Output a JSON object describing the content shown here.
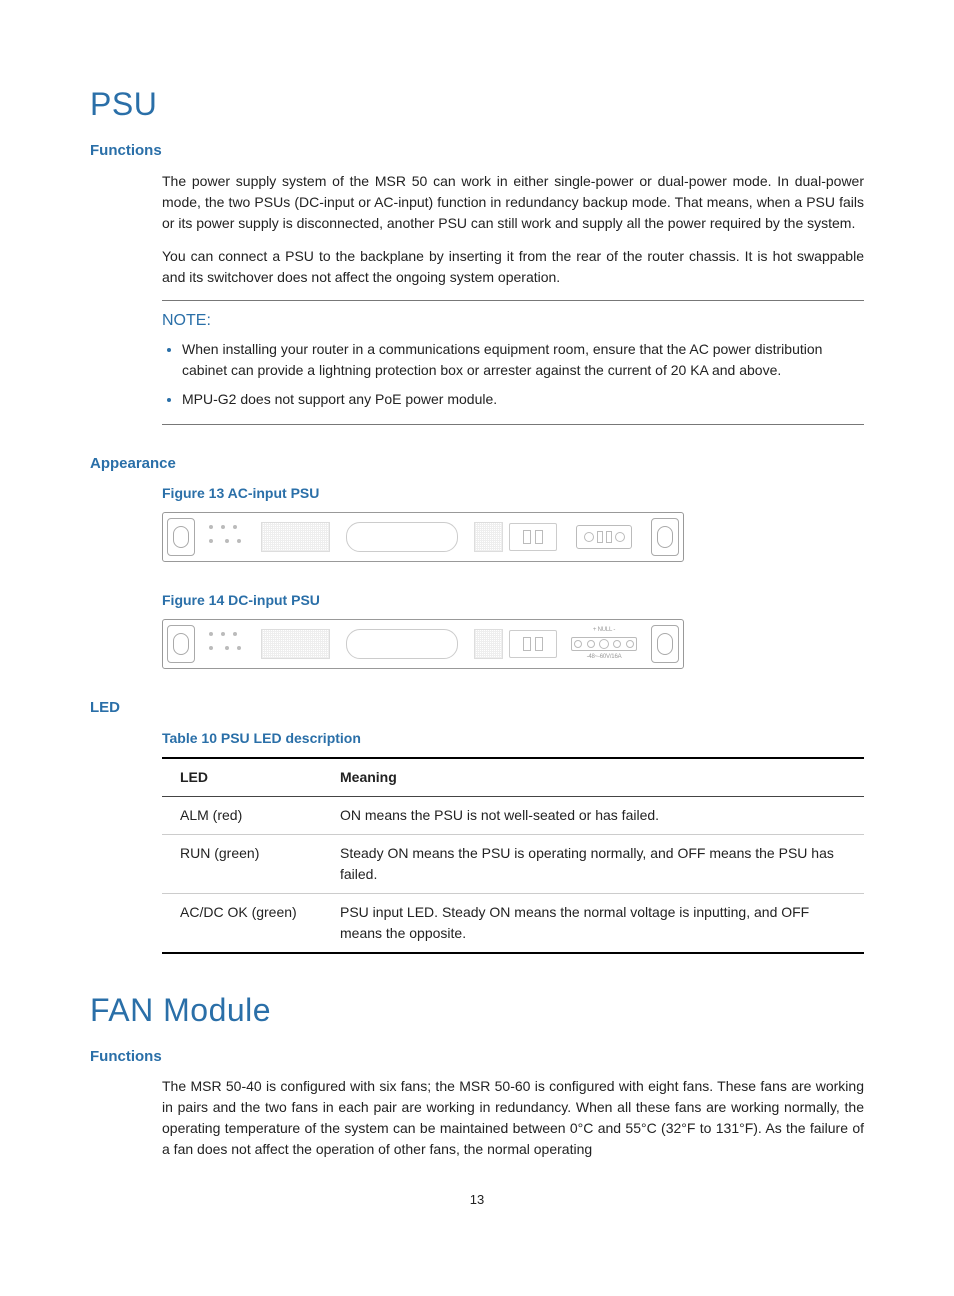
{
  "psu": {
    "title": "PSU",
    "functions": {
      "heading": "Functions",
      "p1": "The power supply system of the MSR 50 can work in either single-power or dual-power mode. In dual-power mode, the two PSUs (DC-input or AC-input) function in redundancy backup mode. That means, when a PSU fails or its power supply is disconnected, another PSU can still work and supply all the power required by the system.",
      "p2": "You can connect a PSU to the backplane by inserting it from the rear of the router chassis. It is hot swappable and its switchover does not affect the ongoing system operation."
    },
    "note": {
      "title": "NOTE:",
      "items": [
        "When installing your router in a communications equipment room, ensure that the AC power distribution cabinet can provide a lightning protection box or arrester against the current of 20 KA and above.",
        "MPU-G2 does not support any PoE power module."
      ]
    },
    "appearance": {
      "heading": "Appearance",
      "fig13": "Figure 13 AC-input PSU",
      "fig14": "Figure 14 DC-input PSU",
      "dc_labels": {
        "top": "+ NULL -",
        "bottom": "-48~-60V/16A"
      }
    },
    "led": {
      "heading": "LED",
      "table_caption": "Table 10 PSU LED description",
      "headers": {
        "c1": "LED",
        "c2": "Meaning"
      },
      "rows": [
        {
          "led": "ALM (red)",
          "meaning": "ON means the PSU is not well-seated or has failed."
        },
        {
          "led": "RUN (green)",
          "meaning": "Steady ON means the PSU is operating normally, and OFF means the PSU has failed."
        },
        {
          "led": "AC/DC OK (green)",
          "meaning": "PSU input LED. Steady ON means the normal voltage is inputting, and OFF means the opposite."
        }
      ]
    }
  },
  "fan": {
    "title": "FAN Module",
    "functions": {
      "heading": "Functions",
      "p1": "The MSR 50-40 is configured with six fans; the MSR 50-60 is configured with eight fans. These fans are working in pairs and the two fans in each pair are working in redundancy. When all these fans are working normally, the operating temperature of the system can be maintained between 0°C and 55°C (32°F to 131°F). As the failure of a fan does not affect the operation of other fans, the normal operating"
    }
  },
  "page_number": "13"
}
